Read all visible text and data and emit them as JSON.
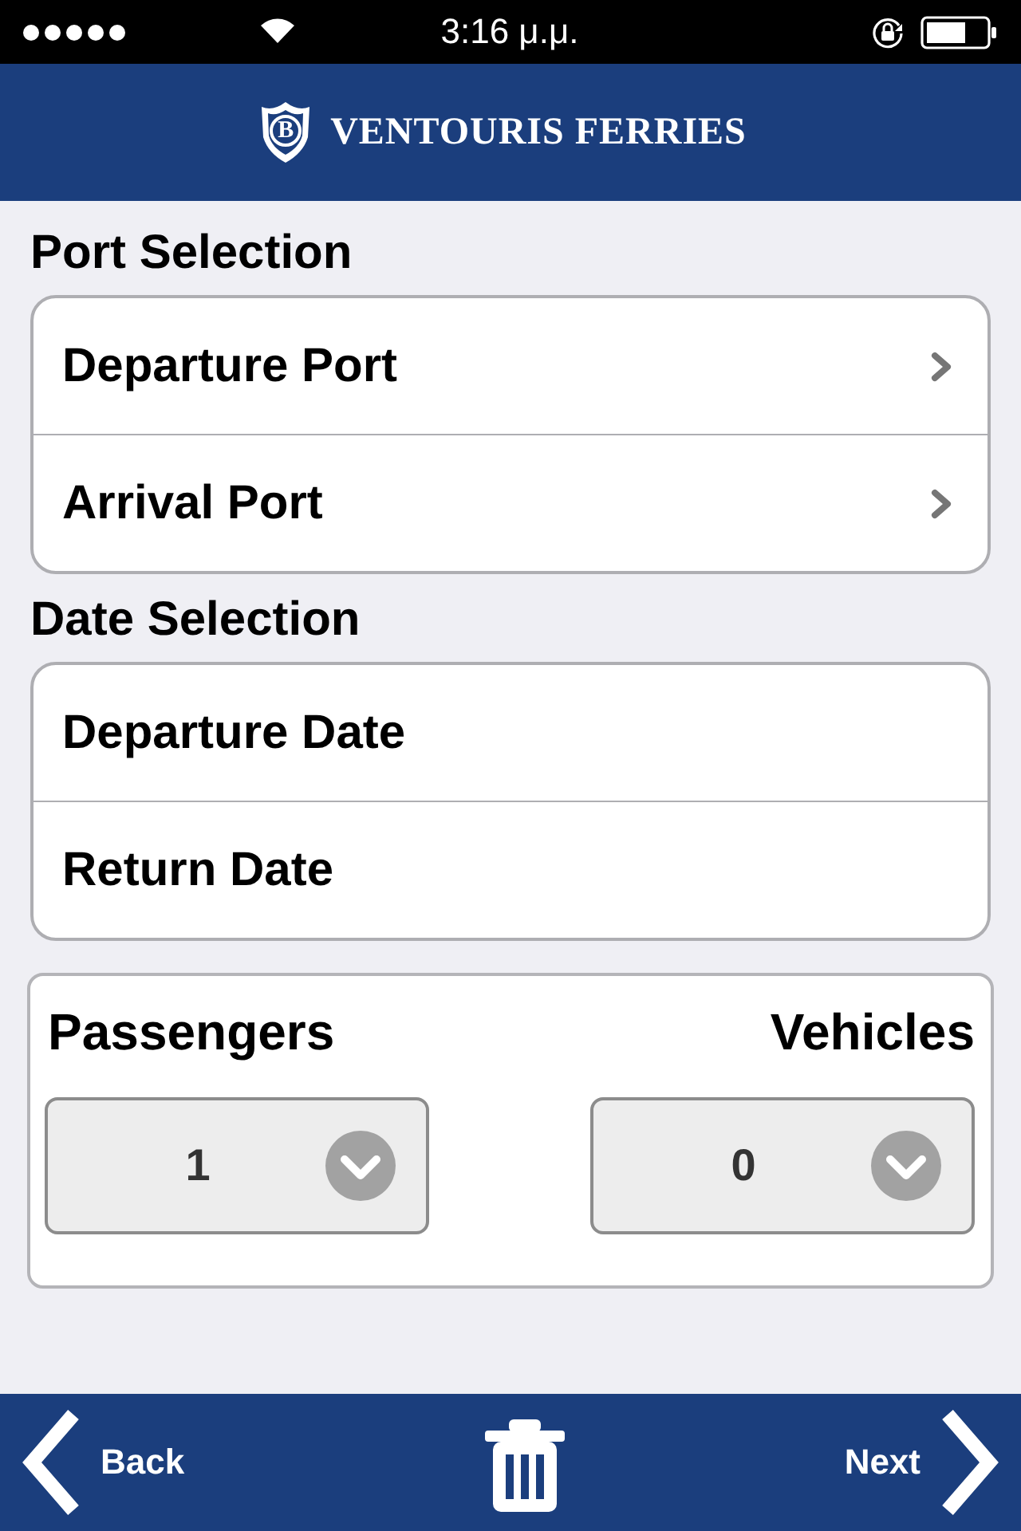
{
  "status_bar": {
    "time": "3:16 μ.μ."
  },
  "header": {
    "logo_letter": "B",
    "brand": "VENTOURIS FERRIES"
  },
  "sections": [
    {
      "title": "Port Selection",
      "rows": [
        {
          "label": "Departure Port",
          "disclosure": true
        },
        {
          "label": "Arrival Port",
          "disclosure": true
        }
      ]
    },
    {
      "title": "Date Selection",
      "rows": [
        {
          "label": "Departure Date",
          "disclosure": false
        },
        {
          "label": "Return Date",
          "disclosure": false
        }
      ]
    }
  ],
  "counts": [
    {
      "label": "Passengers",
      "value": "1"
    },
    {
      "label": "Vehicles",
      "value": "0"
    }
  ],
  "toolbar": {
    "back": "Back",
    "next": "Next"
  }
}
